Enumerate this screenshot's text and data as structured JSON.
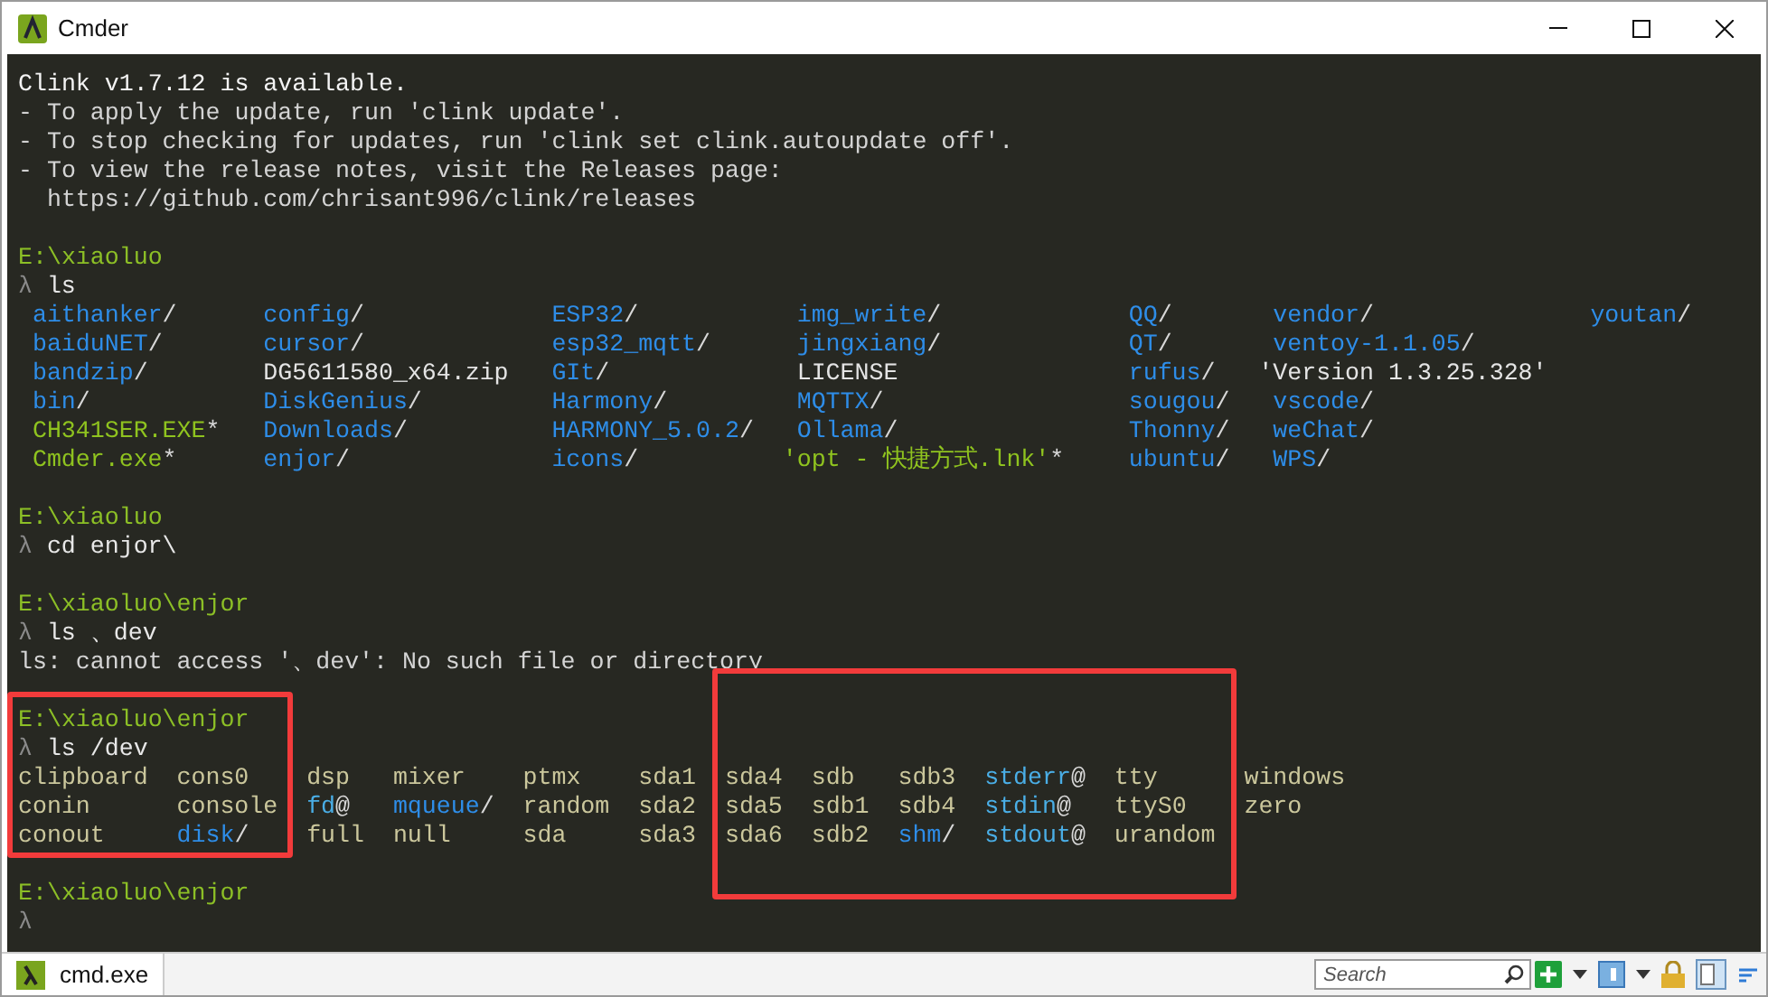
{
  "window": {
    "title": "Cmder"
  },
  "terminal": {
    "lines": [
      {
        "kind": "heading",
        "text": "Clink v1.7.12 is available."
      },
      {
        "kind": "text",
        "text": "- To apply the update, run 'clink update'."
      },
      {
        "kind": "text",
        "text": "- To stop checking for updates, run 'clink set clink.autoupdate off'."
      },
      {
        "kind": "text",
        "text": "- To view the release notes, visit the Releases page:"
      },
      {
        "kind": "text",
        "text": "  https://github.com/chrisant996/clink/releases"
      },
      {
        "kind": "blank"
      },
      {
        "kind": "path",
        "text": "E:\\xiaoluo"
      },
      {
        "kind": "command",
        "prompt": "λ",
        "text": "ls"
      },
      {
        "kind": "listing",
        "rows": [
          [
            {
              "name": "aithanker",
              "suffix": "/",
              "kind": "dir"
            },
            {
              "name": "config",
              "suffix": "/",
              "kind": "dir"
            },
            {
              "name": "ESP32",
              "suffix": "/",
              "kind": "dir"
            },
            {
              "name": "img_write",
              "suffix": "/",
              "kind": "dir"
            },
            {
              "name": "QQ",
              "suffix": "/",
              "kind": "dir"
            },
            {
              "name": "vendor",
              "suffix": "/",
              "kind": "dir"
            },
            {
              "name": "youtan",
              "suffix": "/",
              "kind": "dir"
            }
          ],
          [
            {
              "name": "baiduNET",
              "suffix": "/",
              "kind": "dir"
            },
            {
              "name": "cursor",
              "suffix": "/",
              "kind": "dir"
            },
            {
              "name": "esp32_mqtt",
              "suffix": "/",
              "kind": "dir"
            },
            {
              "name": "jingxiang",
              "suffix": "/",
              "kind": "dir"
            },
            {
              "name": "QT",
              "suffix": "/",
              "kind": "dir"
            },
            {
              "name": "ventoy-1.1.05",
              "suffix": "/",
              "kind": "dir"
            }
          ],
          [
            {
              "name": "bandzip",
              "suffix": "/",
              "kind": "dir"
            },
            {
              "name": "DG5611580_x64.zip",
              "kind": "file"
            },
            {
              "name": "GIt",
              "suffix": "/",
              "kind": "dir"
            },
            {
              "name": "LICENSE",
              "kind": "file"
            },
            {
              "name": "rufus",
              "suffix": "/",
              "kind": "dir"
            },
            {
              "name": "'Version 1.3.25.328'",
              "kind": "file",
              "quoted": true
            }
          ],
          [
            {
              "name": "bin",
              "suffix": "/",
              "kind": "dir"
            },
            {
              "name": "DiskGenius",
              "suffix": "/",
              "kind": "dir"
            },
            {
              "name": "Harmony",
              "suffix": "/",
              "kind": "dir"
            },
            {
              "name": "MQTTX",
              "suffix": "/",
              "kind": "dir"
            },
            {
              "name": "sougou",
              "suffix": "/",
              "kind": "dir"
            },
            {
              "name": "vscode",
              "suffix": "/",
              "kind": "dir"
            }
          ],
          [
            {
              "name": "CH341SER.EXE",
              "suffix": "*",
              "kind": "exe"
            },
            {
              "name": "Downloads",
              "suffix": "/",
              "kind": "dir"
            },
            {
              "name": "HARMONY_5.0.2",
              "suffix": "/",
              "kind": "dir"
            },
            {
              "name": "Ollama",
              "suffix": "/",
              "kind": "dir"
            },
            {
              "name": "Thonny",
              "suffix": "/",
              "kind": "dir"
            },
            {
              "name": "weChat",
              "suffix": "/",
              "kind": "dir"
            }
          ],
          [
            {
              "name": "Cmder.exe",
              "suffix": "*",
              "kind": "exe"
            },
            {
              "name": "enjor",
              "suffix": "/",
              "kind": "dir"
            },
            {
              "name": "icons",
              "suffix": "/",
              "kind": "dir"
            },
            {
              "name": "'opt - 快捷方式.lnk'",
              "suffix": "*",
              "kind": "exe",
              "quoted": true
            },
            {
              "name": "ubuntu",
              "suffix": "/",
              "kind": "dir"
            },
            {
              "name": "WPS",
              "suffix": "/",
              "kind": "dir"
            }
          ]
        ]
      },
      {
        "kind": "blank"
      },
      {
        "kind": "path",
        "text": "E:\\xiaoluo"
      },
      {
        "kind": "command",
        "prompt": "λ",
        "text": "cd enjor\\"
      },
      {
        "kind": "blank"
      },
      {
        "kind": "path",
        "text": "E:\\xiaoluo\\enjor"
      },
      {
        "kind": "command",
        "prompt": "λ",
        "text": "ls 、dev"
      },
      {
        "kind": "text",
        "text": "ls: cannot access '、dev': No such file or directory"
      },
      {
        "kind": "blank"
      },
      {
        "kind": "path",
        "text": "E:\\xiaoluo\\enjor"
      },
      {
        "kind": "command",
        "prompt": "λ",
        "text": "ls /dev"
      },
      {
        "kind": "listing",
        "rows": [
          [
            {
              "name": "clipboard",
              "kind": "device"
            },
            {
              "name": "cons0",
              "kind": "device"
            },
            {
              "name": "dsp",
              "kind": "device"
            },
            {
              "name": "mixer",
              "kind": "device"
            },
            {
              "name": "ptmx",
              "kind": "device"
            },
            {
              "name": "sda1",
              "kind": "device"
            },
            {
              "name": "sda4",
              "kind": "device"
            },
            {
              "name": "sdb",
              "kind": "device"
            },
            {
              "name": "sdb3",
              "kind": "device"
            },
            {
              "name": "stderr",
              "suffix": "@",
              "kind": "link"
            },
            {
              "name": "tty",
              "kind": "device"
            },
            {
              "name": "windows",
              "kind": "device"
            }
          ],
          [
            {
              "name": "conin",
              "kind": "device"
            },
            {
              "name": "console",
              "kind": "device"
            },
            {
              "name": "fd",
              "suffix": "@",
              "kind": "link"
            },
            {
              "name": "mqueue",
              "suffix": "/",
              "kind": "dir"
            },
            {
              "name": "random",
              "kind": "device"
            },
            {
              "name": "sda2",
              "kind": "device"
            },
            {
              "name": "sda5",
              "kind": "device"
            },
            {
              "name": "sdb1",
              "kind": "device"
            },
            {
              "name": "sdb4",
              "kind": "device"
            },
            {
              "name": "stdin",
              "suffix": "@",
              "kind": "link"
            },
            {
              "name": "ttyS0",
              "kind": "device"
            },
            {
              "name": "zero",
              "kind": "device"
            }
          ],
          [
            {
              "name": "conout",
              "kind": "device"
            },
            {
              "name": "disk",
              "suffix": "/",
              "kind": "dir"
            },
            {
              "name": "full",
              "kind": "device"
            },
            {
              "name": "null",
              "kind": "device"
            },
            {
              "name": "sda",
              "kind": "device"
            },
            {
              "name": "sda3",
              "kind": "device"
            },
            {
              "name": "sda6",
              "kind": "device"
            },
            {
              "name": "sdb2",
              "kind": "device"
            },
            {
              "name": "shm",
              "suffix": "/",
              "kind": "dir"
            },
            {
              "name": "stdout",
              "suffix": "@",
              "kind": "link"
            },
            {
              "name": "urandom",
              "kind": "device"
            }
          ]
        ]
      },
      {
        "kind": "blank"
      },
      {
        "kind": "path",
        "text": "E:\\xiaoluo\\enjor"
      },
      {
        "kind": "command",
        "prompt": "λ"
      }
    ]
  },
  "status_bar": {
    "tab": {
      "label": "cmd.exe",
      "selected": true
    },
    "search": {
      "placeholder": "Search"
    }
  }
}
